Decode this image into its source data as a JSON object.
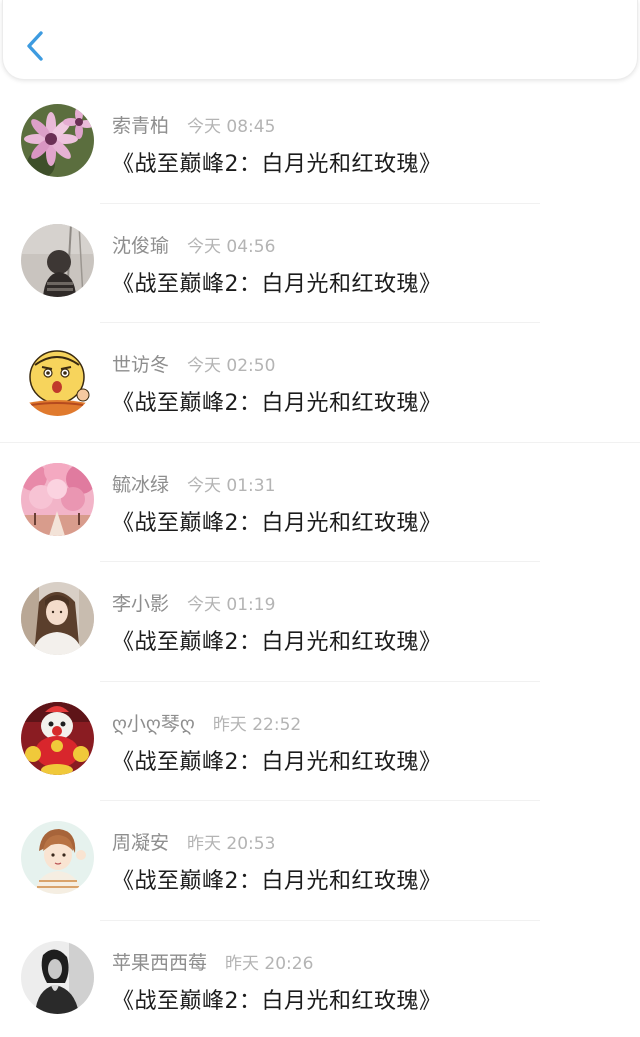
{
  "header": {
    "back_icon": "chevron-left-icon",
    "accent_color": "#3d9be0"
  },
  "messages": [
    {
      "name": "索青柏",
      "time": "今天 08:45",
      "content": "《战至巅峰2：白月光和红玫瑰》",
      "avatar_icon": "flower-avatar"
    },
    {
      "name": "沈俊瑜",
      "time": "今天 04:56",
      "content": "《战至巅峰2：白月光和红玫瑰》",
      "avatar_icon": "person-photo-avatar"
    },
    {
      "name": "世访冬",
      "time": "今天 02:50",
      "content": "《战至巅峰2：白月光和红玫瑰》",
      "avatar_icon": "cartoon-face-avatar"
    },
    {
      "name": "毓冰绿",
      "time": "今天 01:31",
      "content": "《战至巅峰2：白月光和红玫瑰》",
      "avatar_icon": "cherry-blossom-avatar"
    },
    {
      "name": "李小影",
      "time": "今天 01:19",
      "content": "《战至巅峰2：白月光和红玫瑰》",
      "avatar_icon": "girl-photo-avatar"
    },
    {
      "name": "ღ小ღ琴ღ",
      "time": "昨天 22:52",
      "content": "《战至巅峰2：白月光和红玫瑰》",
      "avatar_icon": "clown-toy-avatar"
    },
    {
      "name": "周凝安",
      "time": "昨天 20:53",
      "content": "《战至巅峰2：白月光和红玫瑰》",
      "avatar_icon": "anime-boy-avatar"
    },
    {
      "name": "苹果西西莓",
      "time": "昨天 20:26",
      "content": "《战至巅峰2：白月光和红玫瑰》",
      "avatar_icon": "bw-portrait-avatar"
    }
  ]
}
